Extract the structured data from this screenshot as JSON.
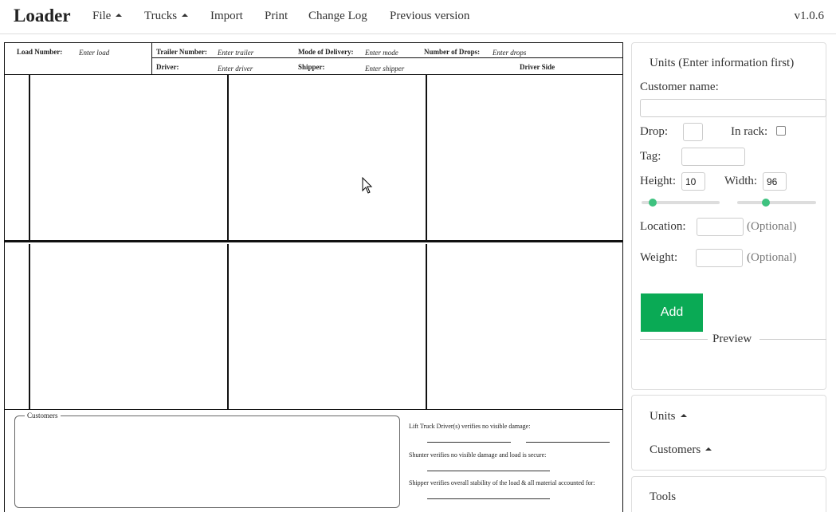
{
  "app": {
    "title": "Loader",
    "version": "v1.0.6"
  },
  "nav": {
    "file": "File",
    "trucks": "Trucks",
    "import": "Import",
    "print": "Print",
    "change_log": "Change Log",
    "previous_version": "Previous version"
  },
  "sheet": {
    "load_number_label": "Load Number:",
    "load_number_value": "Enter load",
    "trailer_number_label": "Trailer Number:",
    "trailer_number_value": "Enter trailer",
    "mode_label": "Mode of Delivery:",
    "mode_value": "Enter mode",
    "drops_label": "Number of Drops:",
    "drops_value": "Enter drops",
    "driver_label": "Driver:",
    "driver_value": "Enter driver",
    "shipper_label": "Shipper:",
    "shipper_value": "Enter shipper",
    "side_label": "Driver Side",
    "customers_legend": "Customers",
    "verify_lift": "Lift Truck Driver(s) verifies no visible damage:",
    "verify_shunter": "Shunter verifies no visible damage and load is secure:",
    "verify_shipper": "Shipper verifies overall stability of the load & all material accounted for:"
  },
  "units_form": {
    "title": "Units (Enter information first)",
    "customer_name_label": "Customer name:",
    "customer_name_value": "",
    "drop_label": "Drop:",
    "drop_value": "",
    "in_rack_label": "In rack:",
    "in_rack_checked": false,
    "tag_label": "Tag:",
    "tag_value": "",
    "height_label": "Height:",
    "height_value": "10",
    "width_label": "Width:",
    "width_value": "96",
    "height_slider_fraction": 0.14,
    "width_slider_fraction": 0.36,
    "location_label": "Location:",
    "location_value": "",
    "optional_hint": "(Optional)",
    "weight_label": "Weight:",
    "weight_value": "",
    "add_button": "Add",
    "preview_label": "Preview"
  },
  "collapsibles": {
    "units": "Units",
    "customers": "Customers",
    "tools": "Tools"
  },
  "colors": {
    "accent_green": "#0aaa55",
    "slider_thumb": "#3ec27f"
  }
}
